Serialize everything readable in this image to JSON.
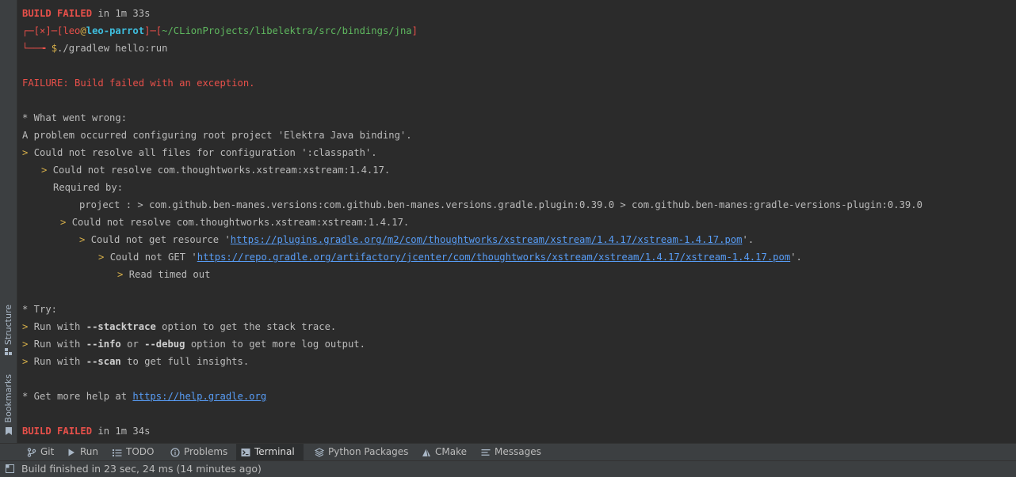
{
  "side": {
    "structure_label": "Structure",
    "bookmarks_label": "Bookmarks"
  },
  "terminal": {
    "l1": {
      "status": "BUILD FAILED",
      "rest": " in 1m 33s"
    },
    "l2": {
      "corner": "┌─[",
      "x": "×",
      "mid": "]─[",
      "user": "leo",
      "at": "@",
      "host": "leo-parrot",
      "mid2": "]─[",
      "path": "~/CLionProjects/libelektra/src/bindings/jna",
      "close": "]"
    },
    "l3": {
      "corner": "└──╼ ",
      "dollar": "$",
      "cmd": "./gradlew hello:run"
    },
    "l5": "FAILURE: Build failed with an exception.",
    "l7": "* What went wrong:",
    "l8": "A problem occurred configuring root project 'Elektra Java binding'.",
    "l9": {
      "arrow": "> ",
      "text": "Could not resolve all files for configuration ':classpath'."
    },
    "l10": {
      "arrow": "> ",
      "text": "Could not resolve com.thoughtworks.xstream:xstream:1.4.17."
    },
    "l11": "Required by:",
    "l12": "project : > com.github.ben-manes.versions:com.github.ben-manes.versions.gradle.plugin:0.39.0 > com.github.ben-manes:gradle-versions-plugin:0.39.0",
    "l13": {
      "arrow": "> ",
      "text": "Could not resolve com.thoughtworks.xstream:xstream:1.4.17."
    },
    "l14": {
      "arrow": "> ",
      "pre": "Could not get resource '",
      "url": "https://plugins.gradle.org/m2/com/thoughtworks/xstream/xstream/1.4.17/xstream-1.4.17.pom",
      "post": "'."
    },
    "l15": {
      "arrow": "> ",
      "pre": "Could not GET '",
      "url": "https://repo.gradle.org/artifactory/jcenter/com/thoughtworks/xstream/xstream/1.4.17/xstream-1.4.17.pom",
      "post": "'."
    },
    "l16": {
      "arrow": "> ",
      "text": "Read timed out"
    },
    "l18": "* Try:",
    "l19": {
      "arrow": "> ",
      "pre": "Run with ",
      "flag": "--stacktrace",
      "post": " option to get the stack trace."
    },
    "l20": {
      "arrow": "> ",
      "pre": "Run with ",
      "flag": "--info",
      "mid": " or ",
      "flag2": "--debug",
      "post": " option to get more log output."
    },
    "l21": {
      "arrow": "> ",
      "pre": "Run with ",
      "flag": "--scan",
      "post": " to get full insights."
    },
    "l23": {
      "pre": "* Get more help at ",
      "url": "https://help.gradle.org"
    },
    "l25": {
      "status": "BUILD FAILED",
      "rest": " in 1m 34s"
    }
  },
  "toolbar": {
    "git": "Git",
    "run": "Run",
    "todo": "TODO",
    "problems": "Problems",
    "terminal": "Terminal",
    "python_packages": "Python Packages",
    "cmake": "CMake",
    "messages": "Messages"
  },
  "statusbar": {
    "text": "Build finished in 23 sec, 24 ms (14 minutes ago)"
  },
  "colors": {
    "background": "#2b2b2b",
    "panel": "#3c3f41",
    "error": "#e8504a",
    "link": "#589df6",
    "arrow": "#d7b04a",
    "host": "#3fbfdf",
    "prompt_path": "#5fb85f"
  }
}
